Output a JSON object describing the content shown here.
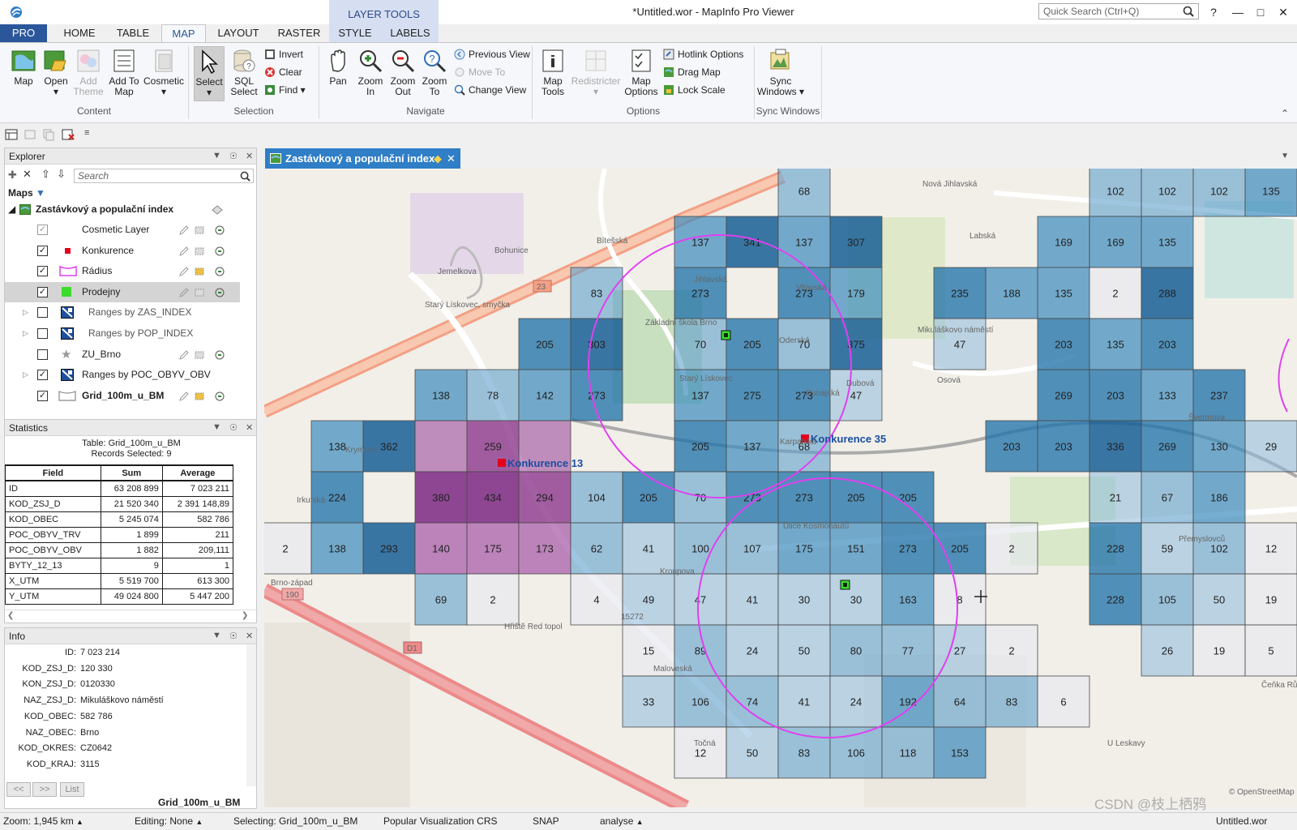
{
  "titlebar": {
    "context_group": "LAYER TOOLS",
    "title": "*Untitled.wor - MapInfo Pro Viewer",
    "quick_search_placeholder": "Quick Search (Ctrl+Q)",
    "help": "?"
  },
  "tabs": [
    "PRO",
    "HOME",
    "TABLE",
    "MAP",
    "LAYOUT",
    "RASTER",
    "STYLE",
    "LABELS"
  ],
  "ribbon": {
    "content": {
      "label": "Content",
      "map": "Map",
      "open": "Open",
      "add_theme": "Add Theme",
      "add_to_map": "Add To Map",
      "cosmetic": "Cosmetic"
    },
    "selection": {
      "label": "Selection",
      "select": "Select",
      "sql_select": "SQL Select",
      "invert": "Invert",
      "clear": "Clear",
      "find": "Find"
    },
    "navigate": {
      "label": "Navigate",
      "pan": "Pan",
      "zoom_in": "Zoom In",
      "zoom_out": "Zoom Out",
      "zoom_to": "Zoom To",
      "previous_view": "Previous View",
      "move_to": "Move To",
      "change_view": "Change View"
    },
    "options": {
      "label": "Options",
      "map_tools": "Map Tools",
      "redistricter": "Redistricter",
      "map_options": "Map Options",
      "hotlink": "Hotlink Options",
      "drag_map": "Drag Map",
      "lock_scale": "Lock Scale"
    },
    "sync": {
      "label": "Sync Windows",
      "sync_windows": "Sync Windows"
    }
  },
  "explorer": {
    "title": "Explorer",
    "search_placeholder": "Search",
    "maps_label": "Maps",
    "map_name": "Zastávkový a populační index",
    "layers": [
      {
        "name": "Cosmetic Layer",
        "checked": true
      },
      {
        "name": "Konkurence",
        "checked": true
      },
      {
        "name": "Rádius",
        "checked": true
      },
      {
        "name": "Prodejny",
        "checked": true
      },
      {
        "name": "Ranges by ZAS_INDEX",
        "checked": false
      },
      {
        "name": "Ranges by POP_INDEX",
        "checked": false
      },
      {
        "name": "ZU_Brno",
        "checked": false
      },
      {
        "name": "Ranges by POC_OBYV_OBV",
        "checked": true
      },
      {
        "name": "Grid_100m_u_BM",
        "checked": true
      }
    ]
  },
  "statistics": {
    "title": "Statistics",
    "table_line": "Table: Grid_100m_u_BM",
    "records_line": "Records Selected: 9",
    "headers": [
      "Field",
      "Sum",
      "Average"
    ],
    "rows": [
      [
        "ID",
        "63 208 899",
        "7 023 211"
      ],
      [
        "KOD_ZSJ_D",
        "21 520 340",
        "2 391 148,89"
      ],
      [
        "KOD_OBEC",
        "5 245 074",
        "582 786"
      ],
      [
        "POC_OBYV_TRV",
        "1 899",
        "211"
      ],
      [
        "POC_OBYV_OBV",
        "1 882",
        "209,111"
      ],
      [
        "BYTY_12_13",
        "9",
        "1"
      ],
      [
        "X_UTM",
        "5 519 700",
        "613 300"
      ],
      [
        "Y_UTM",
        "49 024 800",
        "5 447 200"
      ]
    ]
  },
  "info": {
    "title": "Info",
    "rows": [
      [
        "ID:",
        "7 023 214"
      ],
      [
        "KOD_ZSJ_D:",
        "120 330"
      ],
      [
        "KON_ZSJ_D:",
        "0120330"
      ],
      [
        "NAZ_ZSJ_D:",
        "Mikuláškovo náměstí"
      ],
      [
        "KOD_OBEC:",
        "582 786"
      ],
      [
        "NAZ_OBEC:",
        "Brno"
      ],
      [
        "KOD_OKRES:",
        "CZ0642"
      ],
      [
        "KOD_KRAJ:",
        "3115"
      ]
    ],
    "prev": "<<",
    "next": ">>",
    "list": "List",
    "table": "Grid_100m_u_BM"
  },
  "map": {
    "tab_title": "Zastávkový a populační index",
    "competitors": [
      "Konkurence 13",
      "Konkurence 35"
    ],
    "places": [
      "Bítešská",
      "Starý Lískovec, smyčka",
      "Základní škola Brno",
      "Starý Lískovec",
      "Labská",
      "Nová Jihlavská",
      "Bohunice",
      "Mikuláškovo náměstí",
      "Osová",
      "Brno-západ",
      "Kroupova",
      "Ulice Kosmonautů",
      "Oderská",
      "Vltavská",
      "Dunajská",
      "U Leskavy",
      "Čeňka Růžičky",
      "Švermova",
      "Přemyslovců",
      "Karpatská",
      "Dubová",
      "Hřiště Red topol",
      "Maloveská",
      "Točná",
      "Krymská",
      "Irkutská",
      "Jihlavská",
      "Jemelkova"
    ],
    "road_refs": [
      "23",
      "190",
      "D1",
      "15272"
    ],
    "attribution": "© OpenStreetMap"
  },
  "status": {
    "zoom": "Zoom: 1,945 km",
    "editing": "Editing: None",
    "selecting": "Selecting: Grid_100m_u_BM",
    "crs": "Popular Visualization CRS",
    "snap": "SNAP",
    "analyse": "analyse",
    "workspace": "Untitled.wor"
  },
  "watermark": "CSDN @枝上栖鸦",
  "colors": {
    "ribbon_blue": "#2b579a",
    "map_tab": "#2f7ec6",
    "competitor": "#e3001b",
    "store": "#3ddc2b",
    "radius": "#e040f0"
  }
}
